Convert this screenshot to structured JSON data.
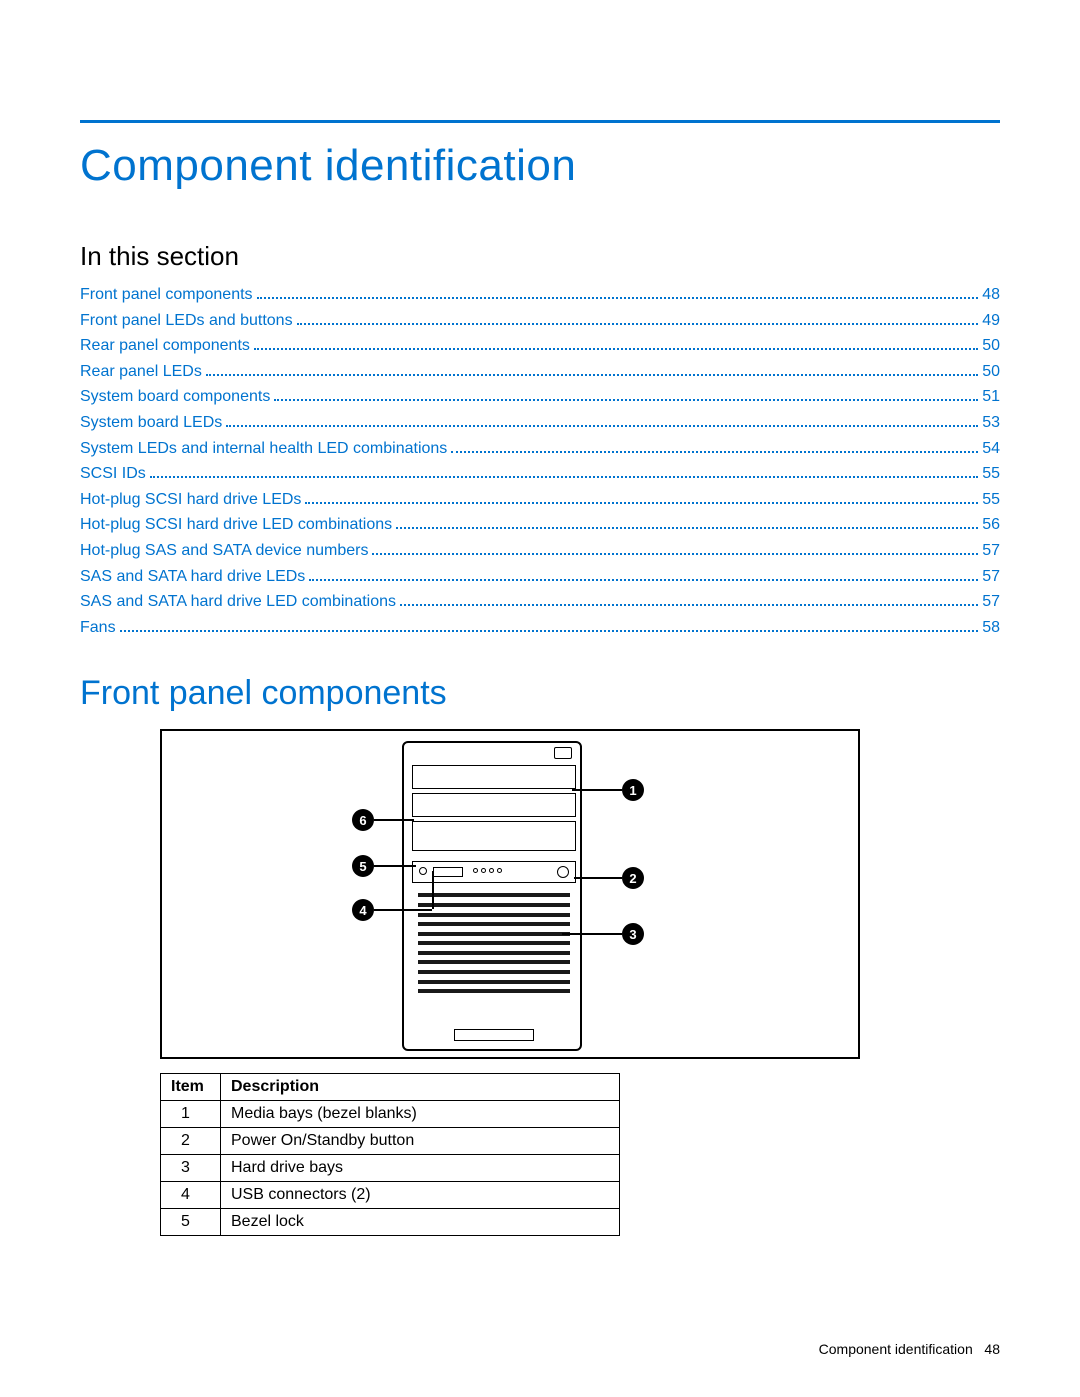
{
  "page_title": "Component identification",
  "section_label": "In this section",
  "toc": [
    {
      "label": "Front panel components",
      "page": "48"
    },
    {
      "label": "Front panel LEDs and buttons",
      "page": "49"
    },
    {
      "label": "Rear panel components",
      "page": "50"
    },
    {
      "label": "Rear panel LEDs",
      "page": "50"
    },
    {
      "label": "System board components",
      "page": "51"
    },
    {
      "label": "System board LEDs",
      "page": "53"
    },
    {
      "label": "System LEDs and internal health LED combinations",
      "page": "54"
    },
    {
      "label": "SCSI IDs",
      "page": "55"
    },
    {
      "label": "Hot-plug SCSI hard drive LEDs",
      "page": "55"
    },
    {
      "label": "Hot-plug SCSI hard drive LED combinations",
      "page": "56"
    },
    {
      "label": "Hot-plug SAS and SATA device numbers",
      "page": "57"
    },
    {
      "label": "SAS and SATA hard drive LEDs",
      "page": "57"
    },
    {
      "label": "SAS and SATA hard drive LED combinations",
      "page": "57"
    },
    {
      "label": "Fans",
      "page": "58"
    }
  ],
  "subhead": "Front panel components",
  "callouts": {
    "c1": "1",
    "c2": "2",
    "c3": "3",
    "c4": "4",
    "c5": "5",
    "c6": "6"
  },
  "table": {
    "headers": {
      "item": "Item",
      "desc": "Description"
    },
    "rows": [
      {
        "item": "1",
        "desc": "Media bays (bezel blanks)"
      },
      {
        "item": "2",
        "desc": "Power On/Standby button"
      },
      {
        "item": "3",
        "desc": "Hard drive bays"
      },
      {
        "item": "4",
        "desc": "USB connectors (2)"
      },
      {
        "item": "5",
        "desc": "Bezel lock"
      }
    ]
  },
  "footer": {
    "label": "Component identification",
    "page": "48"
  }
}
